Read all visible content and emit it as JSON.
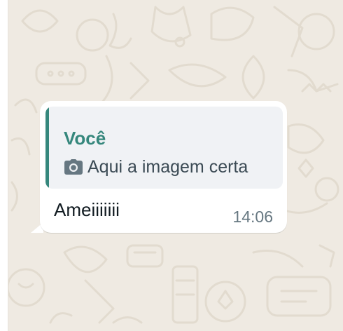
{
  "chat": {
    "background_color": "#efeae2",
    "message": {
      "quoted": {
        "author": "Você",
        "icon": "camera-icon",
        "text": "Aqui a imagem certa",
        "accent_color": "#35877c"
      },
      "text": "Ameiiiiiii",
      "time": "14:06"
    }
  }
}
